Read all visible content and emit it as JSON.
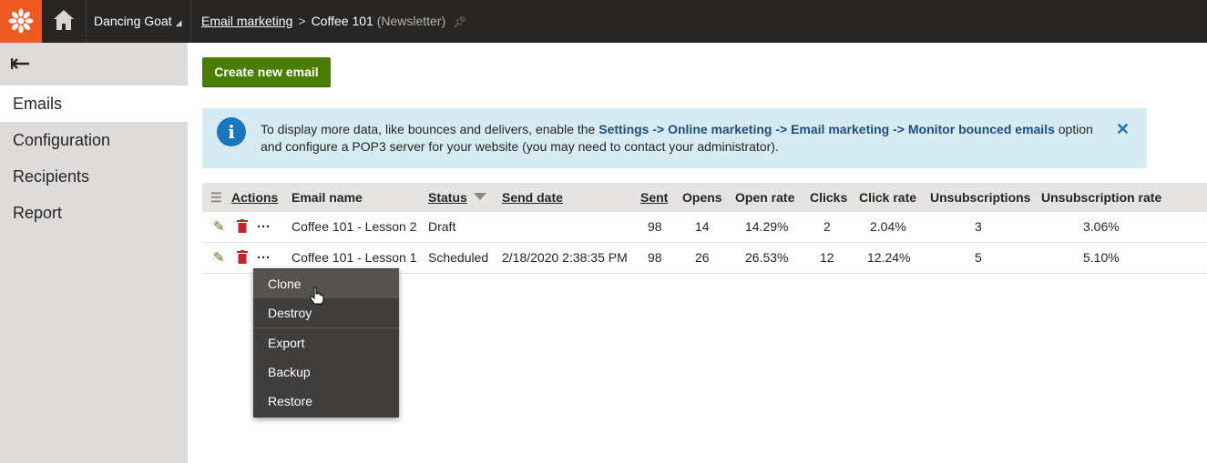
{
  "topbar": {
    "site_name": "Dancing Goat",
    "breadcrumb_parent": "Email marketing",
    "breadcrumb_current": "Coffee 101",
    "breadcrumb_type": "(Newsletter)"
  },
  "sidebar": {
    "items": [
      {
        "label": "Emails",
        "active": true
      },
      {
        "label": "Configuration"
      },
      {
        "label": "Recipients"
      },
      {
        "label": "Report"
      }
    ]
  },
  "main": {
    "create_button": "Create new email",
    "info": {
      "text_1": "To display more data, like bounces and delivers, enable the ",
      "path_1": "Settings",
      "arrow": " -> ",
      "path_2": "Online marketing",
      "path_3": "Email marketing",
      "path_4": "Monitor bounced emails",
      "text_2": " option",
      "text_3": "and configure a POP3 server for your website (you may need to contact your administrator)."
    },
    "table": {
      "headers": {
        "actions": "Actions",
        "email_name": "Email name",
        "status": "Status",
        "send_date": "Send date",
        "sent": "Sent",
        "opens": "Opens",
        "open_rate": "Open rate",
        "clicks": "Clicks",
        "click_rate": "Click rate",
        "unsubscriptions": "Unsubscriptions",
        "unsubscription_rate": "Unsubscription rate"
      },
      "rows": [
        {
          "email_name": "Coffee 101 - Lesson 2",
          "status": "Draft",
          "send_date": "",
          "sent": "98",
          "opens": "14",
          "open_rate": "14.29%",
          "clicks": "2",
          "click_rate": "2.04%",
          "unsubscriptions": "3",
          "unsubscription_rate": "3.06%"
        },
        {
          "email_name": "Coffee 101 - Lesson 1",
          "status": "Scheduled",
          "send_date": "2/18/2020 2:38:35 PM",
          "sent": "98",
          "opens": "26",
          "open_rate": "26.53%",
          "clicks": "12",
          "click_rate": "12.24%",
          "unsubscriptions": "5",
          "unsubscription_rate": "5.10%"
        }
      ]
    }
  },
  "context_menu": {
    "items": [
      "Clone",
      "Destroy",
      "Export",
      "Backup",
      "Restore"
    ],
    "hovered": "Clone"
  },
  "colors": {
    "brand_orange": "#f05a22",
    "topbar": "#272624",
    "primary_green": "#497d04",
    "info_bg": "#d7ebf2",
    "delete_red": "#c0262c"
  },
  "icons": [
    "kentico-logo-icon",
    "home-icon",
    "pin-icon",
    "back-arrow-icon",
    "info-icon",
    "close-icon",
    "menu-lines-icon",
    "sort-down-icon",
    "edit-pencil-icon",
    "delete-trash-icon",
    "more-actions-icon",
    "hand-cursor-icon"
  ]
}
